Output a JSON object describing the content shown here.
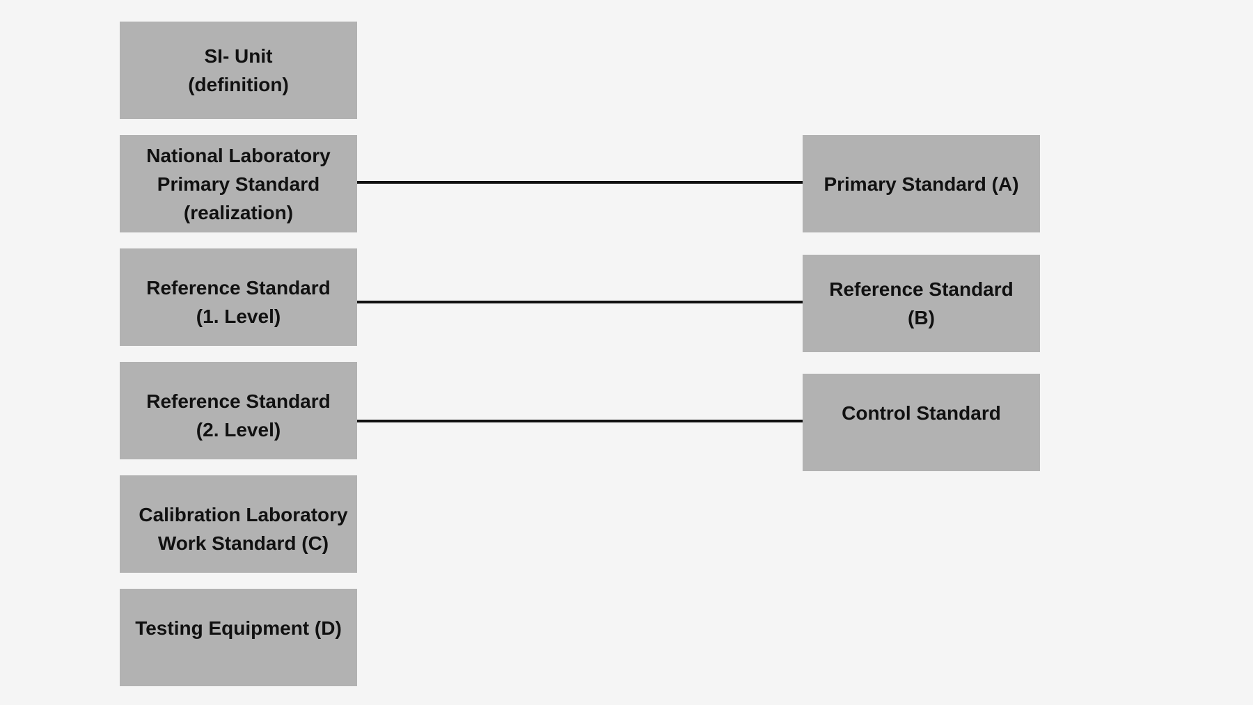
{
  "diagram": {
    "left_column": [
      {
        "id": "si-unit",
        "label": "SI- Unit\n(definition)"
      },
      {
        "id": "national-lab",
        "label": "National Laboratory\nPrimary Standard\n(realization)"
      },
      {
        "id": "ref-level-1",
        "label": "Reference Standard\n(1. Level)"
      },
      {
        "id": "ref-level-2",
        "label": "Reference Standard\n(2. Level)"
      },
      {
        "id": "calibration-lab",
        "label": "Calibration Laboratory\nWork Standard (C)"
      },
      {
        "id": "testing-equipment",
        "label": "Testing Equipment (D)"
      }
    ],
    "right_column": [
      {
        "id": "primary-a",
        "label": "Primary Standard (A)"
      },
      {
        "id": "reference-b",
        "label": "Reference Standard\n(B)"
      },
      {
        "id": "control",
        "label": "Control Standard"
      }
    ],
    "connections": [
      {
        "from": "national-lab",
        "to": "primary-a"
      },
      {
        "from": "ref-level-1",
        "to": "reference-b"
      },
      {
        "from": "ref-level-2",
        "to": "control"
      }
    ],
    "colors": {
      "background": "#f5f5f5",
      "box_fill": "#b2b2b2",
      "text": "#111111",
      "connector": "#111111"
    }
  }
}
